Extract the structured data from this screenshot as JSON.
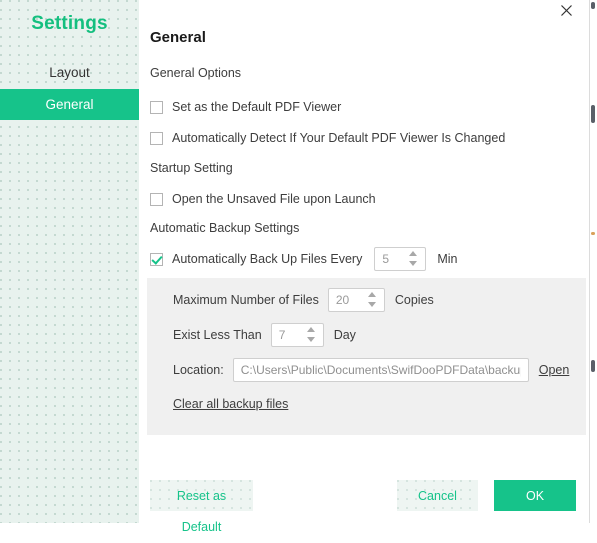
{
  "sidebar": {
    "title": "Settings",
    "items": [
      {
        "label": "Layout",
        "active": false
      },
      {
        "label": "General",
        "active": true
      }
    ]
  },
  "main": {
    "page_title": "General",
    "close_icon": "close-icon",
    "sections": {
      "general_options": {
        "label": "General Options",
        "checkboxes": [
          {
            "label": "Set as the Default PDF Viewer",
            "checked": false
          },
          {
            "label": "Automatically Detect If Your Default PDF Viewer Is Changed",
            "checked": false
          }
        ]
      },
      "startup_setting": {
        "label": "Startup Setting",
        "checkboxes": [
          {
            "label": "Open the Unsaved File upon Launch",
            "checked": false
          }
        ]
      },
      "automatic_backup": {
        "label": "Automatic Backup Settings",
        "enable_label": "Automatically Back Up Files Every",
        "enabled": true,
        "interval_value": "5",
        "interval_unit": "Min",
        "max_files_label": "Maximum Number of Files",
        "max_files_value": "20",
        "max_files_unit": "Copies",
        "exist_less_label": "Exist Less Than",
        "exist_less_value": "7",
        "exist_less_unit": "Day",
        "location_label": "Location:",
        "location_value": "C:\\Users\\Public\\Documents\\SwifDooPDFData\\backup",
        "open_link": "Open",
        "clear_link": "Clear all backup files"
      }
    }
  },
  "footer": {
    "reset_label": "Reset as Default",
    "cancel_label": "Cancel",
    "ok_label": "OK"
  },
  "colors": {
    "accent_green": "#16c38a",
    "title_green": "#14bf7f",
    "sidebar_bg": "#e8f2ee",
    "panel_gray": "#f0f0f0",
    "text": "#3d3d3d"
  }
}
